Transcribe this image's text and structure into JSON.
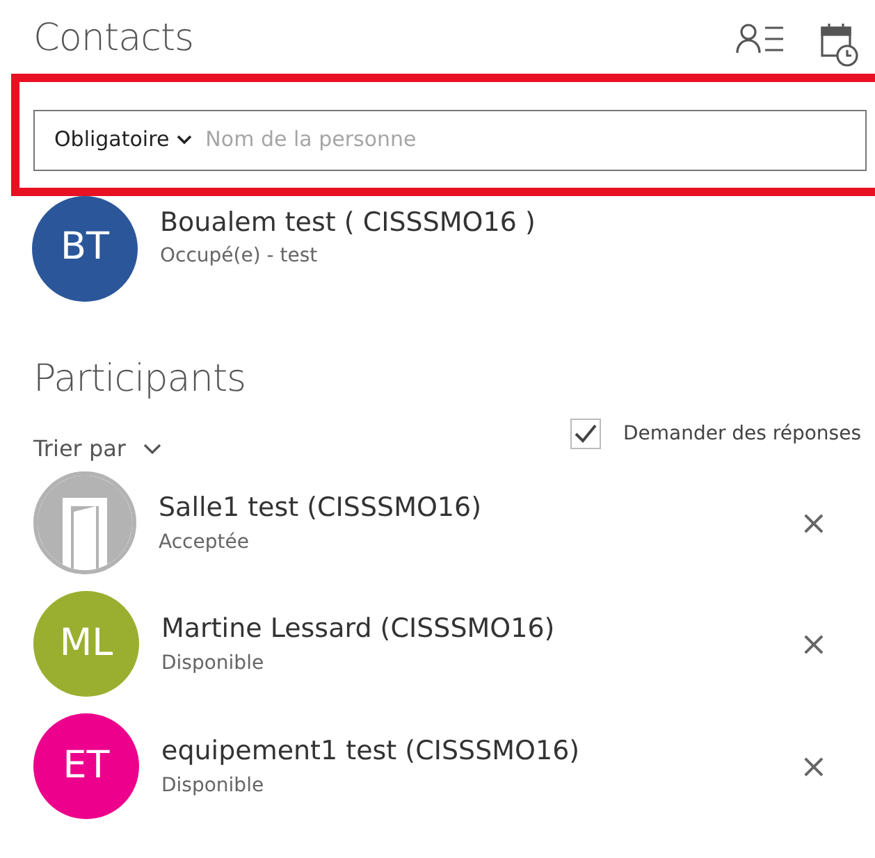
{
  "header": {
    "title": "Contacts"
  },
  "attendee_field": {
    "role": "Obligatoire",
    "placeholder": "Nom de la personne"
  },
  "contact": {
    "initials": "BT",
    "color": "#2b579a",
    "name": "Boualem test ( CISSSMO16 )",
    "status": "Occupé(e) - test"
  },
  "participants": {
    "title": "Participants",
    "sort_label": "Trier par",
    "request_responses": {
      "label": "Demander des réponses",
      "checked": true
    },
    "items": [
      {
        "kind": "room",
        "color": "#b3b3b3",
        "name": "Salle1 test (CISSSMO16)",
        "status": "Acceptée",
        "remove": "×"
      },
      {
        "kind": "person",
        "initials": "ML",
        "color": "#9aaf30",
        "name": "Martine Lessard (CISSSMO16)",
        "status": "Disponible",
        "remove": "×"
      },
      {
        "kind": "person",
        "initials": "ET",
        "color": "#ec008c",
        "name": "equipement1 test (CISSSMO16)",
        "status": "Disponible",
        "remove": "×"
      }
    ]
  }
}
